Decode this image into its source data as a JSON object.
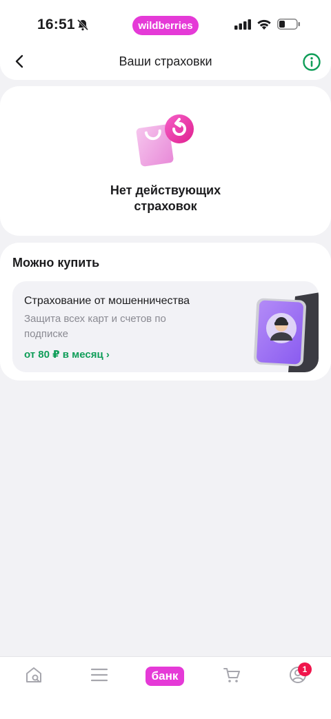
{
  "status_bar": {
    "time": "16:51",
    "brand": "wildberries"
  },
  "header": {
    "title": "Ваши страховки"
  },
  "empty_state": {
    "line1": "Нет действующих",
    "line2": "страховок"
  },
  "offers_section": {
    "title": "Можно купить",
    "offer": {
      "title": "Страхование от мошенничества",
      "description": "Защита всех карт и счетов по подписке",
      "price": "от 80 ₽ в месяц ›"
    }
  },
  "tab_bar": {
    "bank_label": "банк",
    "profile_badge": "1"
  },
  "colors": {
    "brand_pink": "#e53ad7",
    "accent_green": "#0f9d58",
    "badge_red": "#f0154c"
  }
}
